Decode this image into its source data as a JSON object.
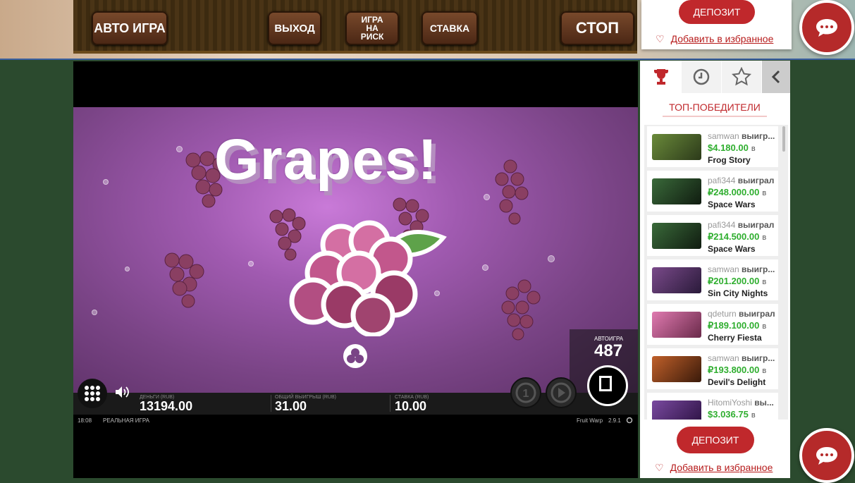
{
  "old_controls": {
    "auto_label": "АВТО ИГРА",
    "exit_label": "ВЫХОД",
    "risk_label": "ИГРА\nНА\nРИСК",
    "bet_label": "СТАВКА",
    "stop_label": "СТОП"
  },
  "top_panel": {
    "deposit_label": "ДЕПОЗИТ",
    "favorite_label": "Добавить в избранное"
  },
  "game": {
    "title": "Grapes!",
    "autoplay_label": "АВТОИГРА",
    "autoplay_count": "487",
    "money_label": "ДЕНЬГИ (RUB)",
    "money_value": "13194.00",
    "win_label": "ОБЩИЙ ВЫИГРЫШ (RUB)",
    "win_value": "31.00",
    "bet_label": "СТАВКА (RUB)",
    "bet_value": "10.00",
    "time": "18:08",
    "mode": "РЕАЛЬНАЯ ИГРА",
    "game_name": "Fruit Warp",
    "version": "2.9.1"
  },
  "sidebar": {
    "tabs": [
      "trophy-icon",
      "clock-icon",
      "star-icon",
      "chevron-left-icon"
    ],
    "title": "ТОП-ПОБЕДИТЕЛИ",
    "winners": [
      {
        "user": "samwan",
        "verb": "выигр...",
        "amount": "$4.180.00",
        "suffix": "в",
        "game": "Frog Story",
        "color": "#6a8a3a"
      },
      {
        "user": "pafi344",
        "verb": "выиграл",
        "amount": "₽248.000.00",
        "suffix": "в",
        "game": "Space Wars",
        "color": "#3a6a3a"
      },
      {
        "user": "pafi344",
        "verb": "выиграл",
        "amount": "₽214.500.00",
        "suffix": "в",
        "game": "Space Wars",
        "color": "#3a6a3a"
      },
      {
        "user": "samwan",
        "verb": "выигр...",
        "amount": "₽201.200.00",
        "suffix": "в",
        "game": "Sin City Nights",
        "color": "#5a3a6a"
      },
      {
        "user": "qdeturn",
        "verb": "выиграл",
        "amount": "₽189.100.00",
        "suffix": "в",
        "game": "Cherry Fiesta",
        "color": "#c0508a"
      },
      {
        "user": "samwan",
        "verb": "выигр...",
        "amount": "₽193.800.00",
        "suffix": "в",
        "game": "Devil's Delight",
        "color": "#a0401a"
      },
      {
        "user": "HitomiYoshi",
        "verb": "вы...",
        "amount": "$3.036.75",
        "suffix": "в",
        "game": "",
        "color": "#5a3a8a"
      }
    ],
    "deposit_label": "ДЕПОЗИТ",
    "favorite_label": "Добавить в избранное"
  }
}
